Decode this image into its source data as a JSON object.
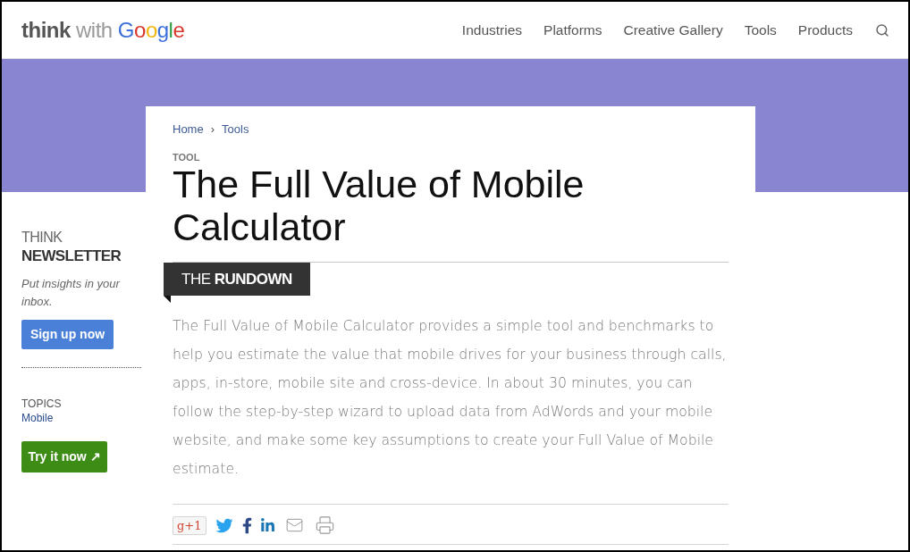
{
  "header": {
    "logo": {
      "words": [
        "think",
        "with",
        "Google"
      ]
    },
    "nav": [
      {
        "label": "Industries"
      },
      {
        "label": "Platforms"
      },
      {
        "label": "Creative Gallery"
      },
      {
        "label": "Tools"
      },
      {
        "label": "Products"
      }
    ]
  },
  "sidebar": {
    "newsletter": {
      "eyebrow": "THINK",
      "title": "NEWSLETTER",
      "text": "Put insights in your inbox.",
      "button": "Sign up now"
    },
    "topics": {
      "heading": "TOPICS",
      "items": [
        "Mobile"
      ]
    },
    "cta_button": "Try it now ↗"
  },
  "article": {
    "breadcrumb": {
      "items": [
        "Home",
        "Tools"
      ],
      "separator": "›"
    },
    "eyebrow": "TOOL",
    "title": "The Full Value of Mobile Calculator",
    "section_tab": "THE **RUNDOWN**",
    "body": "The Full Value of Mobile Calculator provides a simple tool and benchmarks to help you estimate the value that mobile drives for your business through calls, apps, in-store, mobile site and cross-device. In about 30 minutes, you can follow the step-by-step wizard to upload data from AdWords and your mobile website, and make some key assumptions to create your Full Value of Mobile estimate.",
    "share_buttons": [
      {
        "kind": "gplus",
        "label": "g+1"
      },
      {
        "kind": "twitter"
      },
      {
        "kind": "facebook"
      },
      {
        "kind": "linkedin"
      },
      {
        "kind": "email"
      },
      {
        "kind": "print"
      }
    ]
  }
}
